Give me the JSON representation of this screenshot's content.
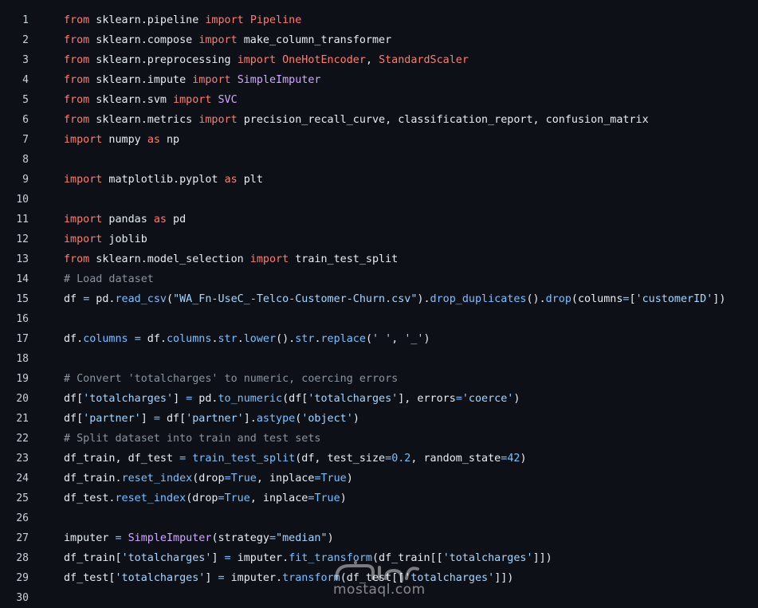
{
  "editor": {
    "colors": {
      "background": "#0d1117",
      "keyword": "#ff7b72",
      "function": "#d2a8ff",
      "constant": "#79c0ff",
      "string": "#a5d6ff",
      "comment": "#8b949e",
      "text": "#e6edf3"
    },
    "lines": [
      {
        "number": "1",
        "tokens": [
          {
            "t": "k",
            "v": "from"
          },
          {
            "t": "p",
            "v": " sklearn.pipeline "
          },
          {
            "t": "k",
            "v": "import"
          },
          {
            "t": "p",
            "v": " "
          },
          {
            "t": "k",
            "v": "Pipeline"
          }
        ]
      },
      {
        "number": "2",
        "tokens": [
          {
            "t": "k",
            "v": "from"
          },
          {
            "t": "p",
            "v": " sklearn.compose "
          },
          {
            "t": "k",
            "v": "import"
          },
          {
            "t": "p",
            "v": " make_column_transformer"
          }
        ]
      },
      {
        "number": "3",
        "tokens": [
          {
            "t": "k",
            "v": "from"
          },
          {
            "t": "p",
            "v": " sklearn.preprocessing "
          },
          {
            "t": "k",
            "v": "import"
          },
          {
            "t": "p",
            "v": " "
          },
          {
            "t": "k",
            "v": "OneHotEncoder"
          },
          {
            "t": "p",
            "v": ", "
          },
          {
            "t": "k",
            "v": "StandardScaler"
          }
        ]
      },
      {
        "number": "4",
        "tokens": [
          {
            "t": "k",
            "v": "from"
          },
          {
            "t": "p",
            "v": " sklearn.impute "
          },
          {
            "t": "k",
            "v": "import"
          },
          {
            "t": "p",
            "v": " "
          },
          {
            "t": "f",
            "v": "SimpleImputer"
          }
        ]
      },
      {
        "number": "5",
        "tokens": [
          {
            "t": "k",
            "v": "from"
          },
          {
            "t": "p",
            "v": " sklearn.svm "
          },
          {
            "t": "k",
            "v": "import"
          },
          {
            "t": "p",
            "v": " "
          },
          {
            "t": "f",
            "v": "SVC"
          }
        ]
      },
      {
        "number": "6",
        "tokens": [
          {
            "t": "k",
            "v": "from"
          },
          {
            "t": "p",
            "v": " sklearn.metrics "
          },
          {
            "t": "k",
            "v": "import"
          },
          {
            "t": "p",
            "v": " precision_recall_curve, classification_report, confusion_matrix"
          }
        ]
      },
      {
        "number": "7",
        "tokens": [
          {
            "t": "k",
            "v": "import"
          },
          {
            "t": "p",
            "v": " numpy "
          },
          {
            "t": "k",
            "v": "as"
          },
          {
            "t": "p",
            "v": " np"
          }
        ]
      },
      {
        "number": "8",
        "tokens": []
      },
      {
        "number": "9",
        "tokens": [
          {
            "t": "k",
            "v": "import"
          },
          {
            "t": "p",
            "v": " matplotlib.pyplot "
          },
          {
            "t": "k",
            "v": "as"
          },
          {
            "t": "p",
            "v": " plt"
          }
        ]
      },
      {
        "number": "10",
        "tokens": []
      },
      {
        "number": "11",
        "tokens": [
          {
            "t": "k",
            "v": "import"
          },
          {
            "t": "p",
            "v": " pandas "
          },
          {
            "t": "k",
            "v": "as"
          },
          {
            "t": "p",
            "v": " pd"
          }
        ]
      },
      {
        "number": "12",
        "tokens": [
          {
            "t": "k",
            "v": "import"
          },
          {
            "t": "p",
            "v": " joblib"
          }
        ]
      },
      {
        "number": "13",
        "tokens": [
          {
            "t": "k",
            "v": "from"
          },
          {
            "t": "p",
            "v": " sklearn.model_selection "
          },
          {
            "t": "k",
            "v": "import"
          },
          {
            "t": "p",
            "v": " train_test_split"
          }
        ]
      },
      {
        "number": "14",
        "tokens": [
          {
            "t": "m",
            "v": "# Load dataset"
          }
        ]
      },
      {
        "number": "15",
        "tokens": [
          {
            "t": "p",
            "v": "df "
          },
          {
            "t": "c",
            "v": "="
          },
          {
            "t": "p",
            "v": " pd."
          },
          {
            "t": "c",
            "v": "read_csv"
          },
          {
            "t": "p",
            "v": "("
          },
          {
            "t": "s",
            "v": "\"WA_Fn-UseC_-Telco-Customer-Churn.csv\""
          },
          {
            "t": "p",
            "v": ")."
          },
          {
            "t": "c",
            "v": "drop_duplicates"
          },
          {
            "t": "p",
            "v": "()."
          },
          {
            "t": "c",
            "v": "drop"
          },
          {
            "t": "p",
            "v": "(columns"
          },
          {
            "t": "c",
            "v": "="
          },
          {
            "t": "p",
            "v": "["
          },
          {
            "t": "s",
            "v": "'customerID'"
          },
          {
            "t": "p",
            "v": "])"
          }
        ]
      },
      {
        "number": "16",
        "tokens": []
      },
      {
        "number": "17",
        "tokens": [
          {
            "t": "p",
            "v": "df."
          },
          {
            "t": "c",
            "v": "columns"
          },
          {
            "t": "p",
            "v": " "
          },
          {
            "t": "c",
            "v": "="
          },
          {
            "t": "p",
            "v": " df."
          },
          {
            "t": "c",
            "v": "columns"
          },
          {
            "t": "p",
            "v": "."
          },
          {
            "t": "c",
            "v": "str"
          },
          {
            "t": "p",
            "v": "."
          },
          {
            "t": "c",
            "v": "lower"
          },
          {
            "t": "p",
            "v": "()."
          },
          {
            "t": "c",
            "v": "str"
          },
          {
            "t": "p",
            "v": "."
          },
          {
            "t": "c",
            "v": "replace"
          },
          {
            "t": "p",
            "v": "("
          },
          {
            "t": "s",
            "v": "' '"
          },
          {
            "t": "p",
            "v": ", "
          },
          {
            "t": "s",
            "v": "'_'"
          },
          {
            "t": "p",
            "v": ")"
          }
        ]
      },
      {
        "number": "18",
        "tokens": []
      },
      {
        "number": "19",
        "tokens": [
          {
            "t": "m",
            "v": "# Convert 'totalcharges' to numeric, coercing errors"
          }
        ]
      },
      {
        "number": "20",
        "tokens": [
          {
            "t": "p",
            "v": "df["
          },
          {
            "t": "s",
            "v": "'totalcharges'"
          },
          {
            "t": "p",
            "v": "] "
          },
          {
            "t": "c",
            "v": "="
          },
          {
            "t": "p",
            "v": " pd."
          },
          {
            "t": "c",
            "v": "to_numeric"
          },
          {
            "t": "p",
            "v": "(df["
          },
          {
            "t": "s",
            "v": "'totalcharges'"
          },
          {
            "t": "p",
            "v": "], errors"
          },
          {
            "t": "c",
            "v": "="
          },
          {
            "t": "s",
            "v": "'coerce'"
          },
          {
            "t": "p",
            "v": ")"
          }
        ]
      },
      {
        "number": "21",
        "tokens": [
          {
            "t": "p",
            "v": "df["
          },
          {
            "t": "s",
            "v": "'partner'"
          },
          {
            "t": "p",
            "v": "] "
          },
          {
            "t": "c",
            "v": "="
          },
          {
            "t": "p",
            "v": " df["
          },
          {
            "t": "s",
            "v": "'partner'"
          },
          {
            "t": "p",
            "v": "]."
          },
          {
            "t": "c",
            "v": "astype"
          },
          {
            "t": "p",
            "v": "("
          },
          {
            "t": "s",
            "v": "'object'"
          },
          {
            "t": "p",
            "v": ")"
          }
        ]
      },
      {
        "number": "22",
        "tokens": [
          {
            "t": "m",
            "v": "# Split dataset into train and test sets"
          }
        ]
      },
      {
        "number": "23",
        "tokens": [
          {
            "t": "p",
            "v": "df_train, df_test "
          },
          {
            "t": "c",
            "v": "="
          },
          {
            "t": "p",
            "v": " "
          },
          {
            "t": "c",
            "v": "train_test_split"
          },
          {
            "t": "p",
            "v": "(df, test_size"
          },
          {
            "t": "c",
            "v": "="
          },
          {
            "t": "c",
            "v": "0.2"
          },
          {
            "t": "p",
            "v": ", random_state"
          },
          {
            "t": "c",
            "v": "="
          },
          {
            "t": "c",
            "v": "42"
          },
          {
            "t": "p",
            "v": ")"
          }
        ]
      },
      {
        "number": "24",
        "tokens": [
          {
            "t": "p",
            "v": "df_train."
          },
          {
            "t": "c",
            "v": "reset_index"
          },
          {
            "t": "p",
            "v": "(drop"
          },
          {
            "t": "c",
            "v": "="
          },
          {
            "t": "c",
            "v": "True"
          },
          {
            "t": "p",
            "v": ", inplace"
          },
          {
            "t": "c",
            "v": "="
          },
          {
            "t": "c",
            "v": "True"
          },
          {
            "t": "p",
            "v": ")"
          }
        ]
      },
      {
        "number": "25",
        "tokens": [
          {
            "t": "p",
            "v": "df_test."
          },
          {
            "t": "c",
            "v": "reset_index"
          },
          {
            "t": "p",
            "v": "(drop"
          },
          {
            "t": "c",
            "v": "="
          },
          {
            "t": "c",
            "v": "True"
          },
          {
            "t": "p",
            "v": ", inplace"
          },
          {
            "t": "c",
            "v": "="
          },
          {
            "t": "c",
            "v": "True"
          },
          {
            "t": "p",
            "v": ")"
          }
        ]
      },
      {
        "number": "26",
        "tokens": []
      },
      {
        "number": "27",
        "tokens": [
          {
            "t": "p",
            "v": "imputer "
          },
          {
            "t": "c",
            "v": "="
          },
          {
            "t": "p",
            "v": " "
          },
          {
            "t": "f",
            "v": "SimpleImputer"
          },
          {
            "t": "p",
            "v": "(strategy"
          },
          {
            "t": "c",
            "v": "="
          },
          {
            "t": "s",
            "v": "\"median\""
          },
          {
            "t": "p",
            "v": ")"
          }
        ]
      },
      {
        "number": "28",
        "tokens": [
          {
            "t": "p",
            "v": "df_train["
          },
          {
            "t": "s",
            "v": "'totalcharges'"
          },
          {
            "t": "p",
            "v": "] "
          },
          {
            "t": "c",
            "v": "="
          },
          {
            "t": "p",
            "v": " imputer."
          },
          {
            "t": "c",
            "v": "fit_transform"
          },
          {
            "t": "p",
            "v": "(df_train[["
          },
          {
            "t": "s",
            "v": "'totalcharges'"
          },
          {
            "t": "p",
            "v": "]])"
          }
        ]
      },
      {
        "number": "29",
        "tokens": [
          {
            "t": "p",
            "v": "df_test["
          },
          {
            "t": "s",
            "v": "'totalcharges'"
          },
          {
            "t": "p",
            "v": "] "
          },
          {
            "t": "c",
            "v": "="
          },
          {
            "t": "p",
            "v": " imputer."
          },
          {
            "t": "c",
            "v": "transform"
          },
          {
            "t": "p",
            "v": "(df_test[["
          },
          {
            "t": "s",
            "v": "'totalcharges'"
          },
          {
            "t": "p",
            "v": "]])"
          }
        ]
      },
      {
        "number": "30",
        "tokens": []
      }
    ]
  },
  "watermark": {
    "text": "mostaql.com",
    "logo_icon": "mostaql-logo-icon"
  }
}
